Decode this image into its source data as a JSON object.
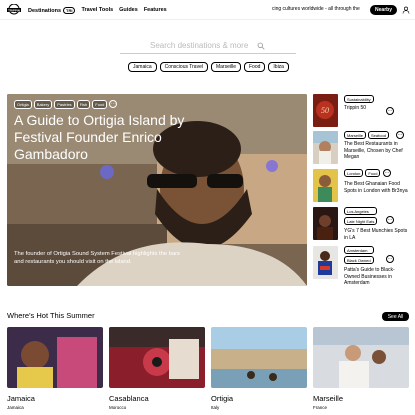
{
  "header": {
    "logo_text": "TRIPPIN",
    "nav": [
      {
        "label": "Destinations",
        "badge": "TRI"
      },
      {
        "label": "Travel Tools"
      },
      {
        "label": "Guides"
      },
      {
        "label": "Features"
      }
    ],
    "ticker": "cing cultures worldwide - all through the",
    "nearby_label": "Nearby"
  },
  "search": {
    "placeholder": "Search destinations & more"
  },
  "chips": [
    "Jamaica",
    "Conscious Travel",
    "Marseille",
    "Food",
    "Ibiza"
  ],
  "hero": {
    "tags": [
      "Ortigia",
      "Bakery",
      "Pastries",
      "Fish",
      "Food"
    ],
    "more": "···",
    "title": "A Guide to Ortigia Island by Festival Founder Enrico Gambadoro",
    "description": "The founder of Ortigia Sound System Festival highlights the bars and restaurants you should visit on the island."
  },
  "sidebar": [
    {
      "tags": [
        "Sustainability"
      ],
      "title": "Trippin 50"
    },
    {
      "tags": [
        "Marseille",
        "Seafood"
      ],
      "title": "The Best Restaurants in Marseille, Chosen by Chef Megan"
    },
    {
      "tags": [
        "London",
        "Food"
      ],
      "title": "The Best Ghanaian Food Spots in London with Br3nya"
    },
    {
      "tags": [
        "Los Angeles",
        "Late Night Eats"
      ],
      "title": "YG's 7 Best Munchies Spots in LA"
    },
    {
      "tags": [
        "Amsterdam",
        "Black Owned"
      ],
      "title": "Patta's Guide to Black-Owned Businesses in Amsterdam"
    }
  ],
  "section": {
    "title": "Where's Hot This Summer",
    "see_all": "See All"
  },
  "cards": [
    {
      "name": "Jamaica",
      "country": "Jamaica"
    },
    {
      "name": "Casablanca",
      "country": "Morocco"
    },
    {
      "name": "Ortigia",
      "country": "Italy"
    },
    {
      "name": "Marseille",
      "country": "France"
    }
  ],
  "colors": {
    "accent": "#000000",
    "hero_overlay": "#6d5a45"
  }
}
